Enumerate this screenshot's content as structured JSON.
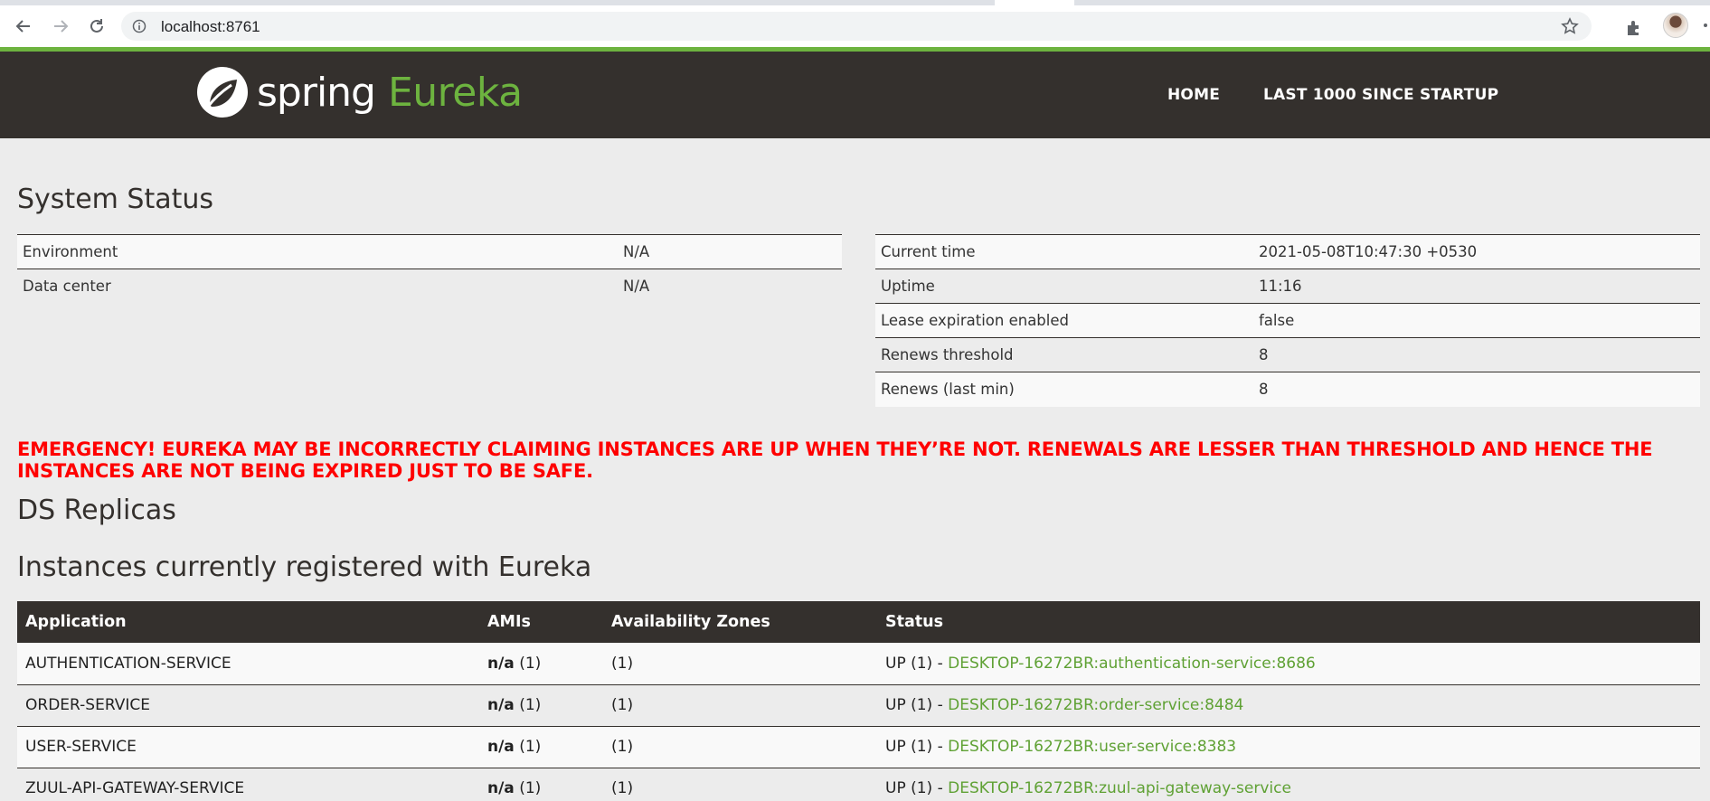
{
  "browser": {
    "url": "localhost:8761"
  },
  "header": {
    "logo_spring": "spring",
    "logo_eureka": "Eureka",
    "nav_home": "HOME",
    "nav_last": "LAST 1000 SINCE STARTUP"
  },
  "system_status": {
    "title": "System Status",
    "left": [
      {
        "label": "Environment",
        "value": "N/A"
      },
      {
        "label": "Data center",
        "value": "N/A"
      }
    ],
    "right": [
      {
        "label": "Current time",
        "value": "2021-05-08T10:47:30 +0530"
      },
      {
        "label": "Uptime",
        "value": "11:16"
      },
      {
        "label": "Lease expiration enabled",
        "value": "false"
      },
      {
        "label": "Renews threshold",
        "value": "8"
      },
      {
        "label": "Renews (last min)",
        "value": "8"
      }
    ]
  },
  "emergency": "EMERGENCY! EUREKA MAY BE INCORRECTLY CLAIMING INSTANCES ARE UP WHEN THEY’RE NOT. RENEWALS ARE LESSER THAN THRESHOLD AND HENCE THE INSTANCES ARE NOT BEING EXPIRED JUST TO BE SAFE.",
  "ds_replicas": {
    "title": "DS Replicas"
  },
  "instances": {
    "title": "Instances currently registered with Eureka",
    "columns": [
      "Application",
      "AMIs",
      "Availability Zones",
      "Status"
    ],
    "rows": [
      {
        "application": "AUTHENTICATION-SERVICE",
        "amis_bold": "n/a",
        "amis_count": " (1)",
        "zones": "(1)",
        "status_prefix": "UP (1) - ",
        "status_link": "DESKTOP-16272BR:authentication-service:8686"
      },
      {
        "application": "ORDER-SERVICE",
        "amis_bold": "n/a",
        "amis_count": " (1)",
        "zones": "(1)",
        "status_prefix": "UP (1) - ",
        "status_link": "DESKTOP-16272BR:order-service:8484"
      },
      {
        "application": "USER-SERVICE",
        "amis_bold": "n/a",
        "amis_count": " (1)",
        "zones": "(1)",
        "status_prefix": "UP (1) - ",
        "status_link": "DESKTOP-16272BR:user-service:8383"
      },
      {
        "application": "ZUUL-API-GATEWAY-SERVICE",
        "amis_bold": "n/a",
        "amis_count": " (1)",
        "zones": "(1)",
        "status_prefix": "UP (1) - ",
        "status_link": "DESKTOP-16272BR:zuul-api-gateway-service"
      }
    ]
  }
}
